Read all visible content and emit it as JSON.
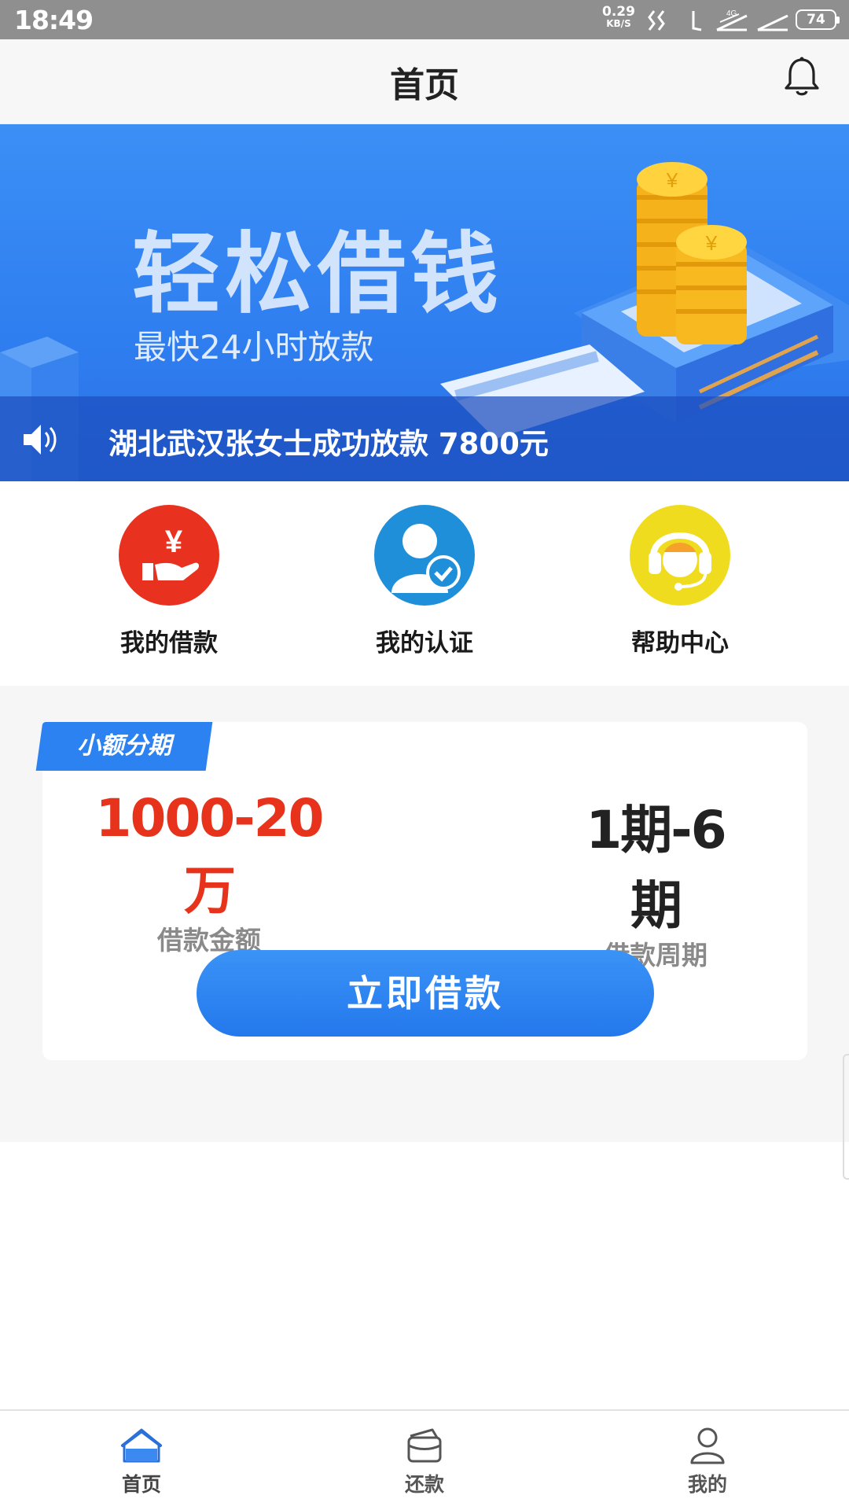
{
  "status_bar": {
    "time": "18:49",
    "net_speed": "0.29",
    "net_unit": "KB/S",
    "network_type": "4G",
    "battery": "74"
  },
  "header": {
    "title": "首页",
    "bell_icon": "bell-icon"
  },
  "banner": {
    "headline": "轻松借钱",
    "subline": "最快24小时放款",
    "ticker_message": "湖北武汉张女士成功放款 7800元",
    "ticker_icon": "speaker-icon"
  },
  "quick_actions": [
    {
      "label": "我的借款",
      "icon": "hand-yuan-icon",
      "color": "#e8321f"
    },
    {
      "label": "我的认证",
      "icon": "user-verified-icon",
      "color": "#1e8fd8"
    },
    {
      "label": "帮助中心",
      "icon": "customer-service-icon",
      "color": "#f0dc1f"
    }
  ],
  "loan_card": {
    "tag": "小额分期",
    "amount_value": "1000-20万",
    "amount_caption": "借款金额",
    "period_value": "1期-6期",
    "period_caption": "借款周期",
    "button": "立即借款",
    "amount_color": "#e8331c",
    "accent_color": "#2b82f0"
  },
  "tabbar": {
    "items": [
      {
        "label": "首页",
        "icon": "home-icon",
        "active": true
      },
      {
        "label": "还款",
        "icon": "wallet-icon",
        "active": false
      },
      {
        "label": "我的",
        "icon": "person-icon",
        "active": false
      }
    ]
  }
}
